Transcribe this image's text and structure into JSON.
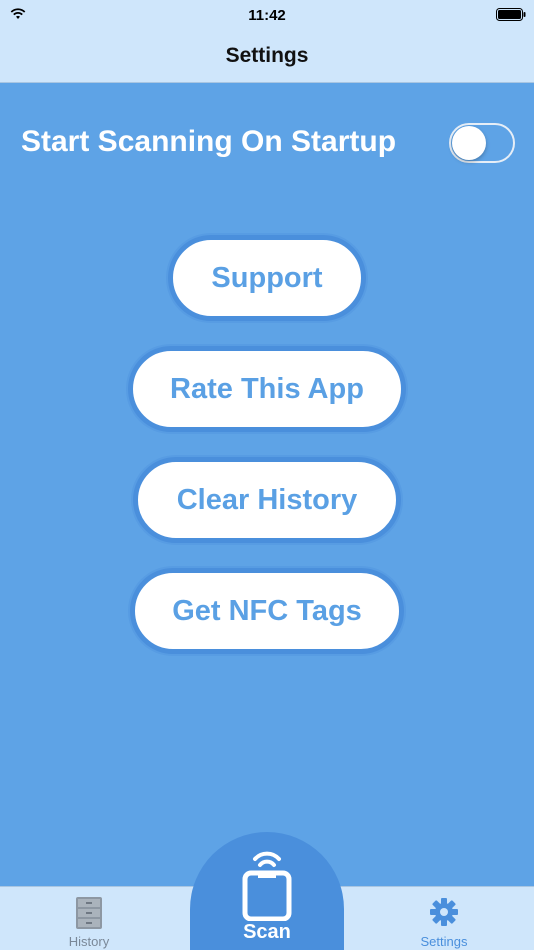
{
  "status_bar": {
    "time": "11:42"
  },
  "nav": {
    "title": "Settings"
  },
  "settings": {
    "startup_scan_label": "Start Scanning On Startup",
    "startup_scan_enabled": false
  },
  "buttons": {
    "support": "Support",
    "rate": "Rate This App",
    "clear_history": "Clear History",
    "get_tags": "Get NFC Tags"
  },
  "tabs": {
    "history": "History",
    "scan": "Scan",
    "settings": "Settings",
    "active": "Settings"
  },
  "colors": {
    "background": "#5ea3e6",
    "bars": "#cfe6fb",
    "accent": "#4a8fdc",
    "button_text": "#5aa0e4"
  },
  "icons": {
    "wifi": "wifi-icon",
    "battery": "battery-icon",
    "history": "cabinet-icon",
    "scan": "nfc-phone-icon",
    "settings": "gear-icon"
  }
}
